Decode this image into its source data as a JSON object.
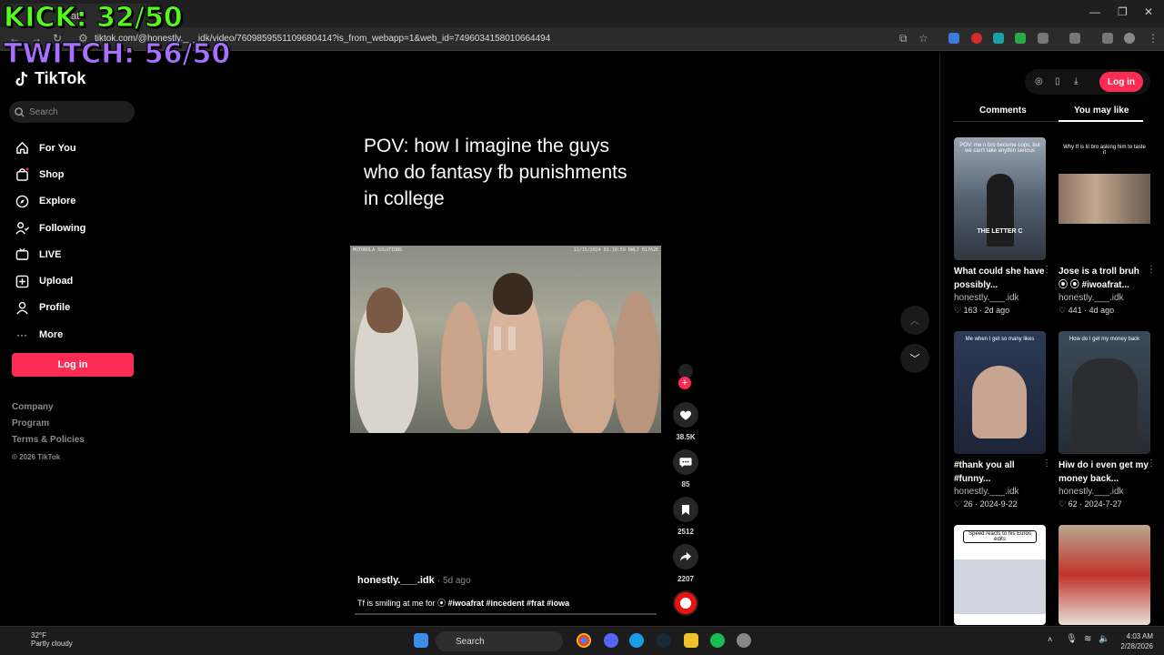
{
  "browser": {
    "tab_title": "at",
    "url": "tiktok.com/@honestly.___idk/video/7609859551109680414?is_from_webapp=1&web_id=7496034158010664494"
  },
  "overlay": {
    "kick": "KICK: 32/50",
    "twitch": "TWITCH: 56/50"
  },
  "sidebar": {
    "logo": "TikTok",
    "search_placeholder": "Search",
    "nav": [
      {
        "label": "For You",
        "icon": "home-icon"
      },
      {
        "label": "Shop",
        "icon": "shop-icon"
      },
      {
        "label": "Explore",
        "icon": "compass-icon"
      },
      {
        "label": "Following",
        "icon": "following-icon"
      },
      {
        "label": "LIVE",
        "icon": "live-icon"
      },
      {
        "label": "Upload",
        "icon": "upload-icon"
      },
      {
        "label": "Profile",
        "icon": "profile-icon"
      },
      {
        "label": "More",
        "icon": "more-icon"
      }
    ],
    "login_label": "Log in",
    "footer": [
      "Company",
      "Program",
      "Terms & Policies"
    ],
    "copyright": "© 2026 TikTok"
  },
  "video": {
    "caption": "POV: how I imagine the guys who do fantasy fb punishments in college",
    "stamp_left": "MOTOROLA SOLUTIONS",
    "stamp_right": "11/15/2024 01:10:59   BWL7 01762E",
    "author": "honestly.___.idk",
    "age": "· 5d ago",
    "desc_text": "Tf is smiling at me for ⦿ ",
    "desc_tags": "#iwoafrat #incedent #frat #iowa",
    "likes": "38.5K",
    "comments": "85",
    "saves": "2512",
    "shares": "2207"
  },
  "right_panel": {
    "login_label": "Log in",
    "tabs": [
      "Comments",
      "You may like"
    ],
    "active_tab": "You may like",
    "cards": [
      {
        "thumb_text": "POV: me n bro become cops, but we can't take anythin serious",
        "thumb_label": "THE LETTER C",
        "title": "What could she have possibly...",
        "author": "honestly.___.idk",
        "likes": "163",
        "date": "2d ago"
      },
      {
        "thumb_text": "Why tf is lil bro asking him to taste it",
        "thumb_label": "",
        "title": "Jose is a troll bruh ⦿ ⦿ #iwoafrat...",
        "author": "honestly.___.idk",
        "likes": "441",
        "date": "4d ago"
      },
      {
        "thumb_text": "Me when I get so many likes",
        "thumb_label": "",
        "title": "#thank you all #funny...",
        "author": "honestly.___.idk",
        "likes": "26",
        "date": "2024-9-22"
      },
      {
        "thumb_text": "How do I get my money back",
        "thumb_label": "",
        "title": "Hiw do i even get my money back...",
        "author": "honestly.___.idk",
        "likes": "62",
        "date": "2024-7-27"
      },
      {
        "thumb_text": "Speed reacts to his Euros edits",
        "thumb_label": "",
        "title": "",
        "author": "",
        "likes": "",
        "date": ""
      },
      {
        "thumb_text": "",
        "thumb_label": "",
        "title": "",
        "author": "",
        "likes": "",
        "date": ""
      }
    ]
  },
  "taskbar": {
    "temp": "32°F",
    "weather": "Partly cloudy",
    "search": "Search",
    "time": "4:03 AM",
    "date": "2/28/2026"
  },
  "colors": {
    "brand": "#fe2c55",
    "kick": "#53fc18",
    "twitch": "#a970ff"
  }
}
